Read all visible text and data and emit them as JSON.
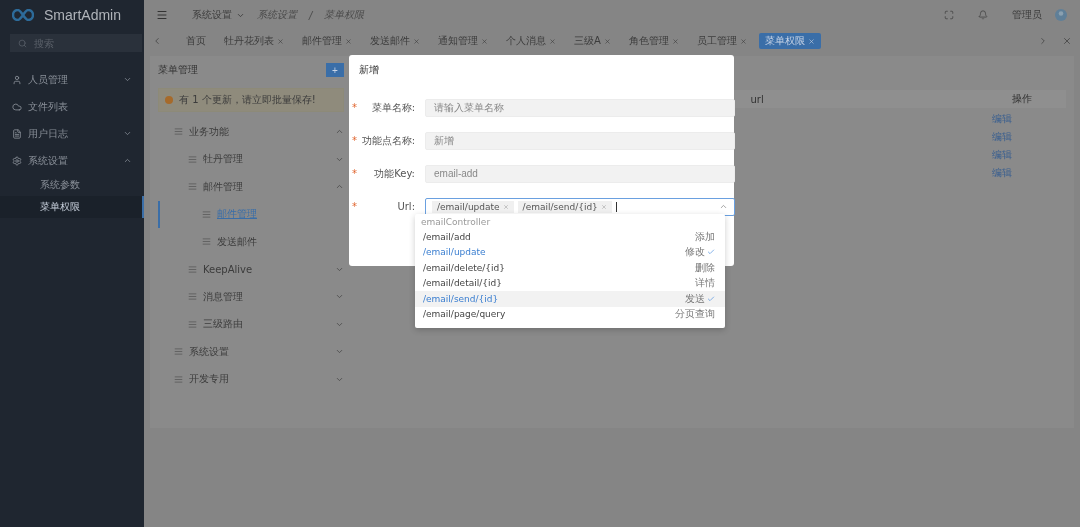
{
  "app": {
    "name": "SmartAdmin"
  },
  "sidebar": {
    "search_placeholder": "搜索",
    "items": [
      {
        "label": "人员管理",
        "expanded": false,
        "has_children": true,
        "selected": false
      },
      {
        "label": "文件列表",
        "has_children": false,
        "selected": false
      },
      {
        "label": "用户日志",
        "expanded": false,
        "has_children": true,
        "selected": false
      },
      {
        "label": "系统设置",
        "expanded": true,
        "has_children": true,
        "selected": false,
        "children": [
          {
            "label": "系统参数",
            "selected": false
          },
          {
            "label": "菜单权限",
            "selected": true
          }
        ]
      }
    ]
  },
  "header": {
    "module": "系统设置",
    "breadcrumb": [
      "系统设置",
      "菜单权限"
    ],
    "breadcrumb_separator": "/",
    "user": "管理员"
  },
  "tabs": [
    {
      "label": "首页",
      "selected": false,
      "closable": false
    },
    {
      "label": "牡丹花列表",
      "selected": false,
      "closable": true
    },
    {
      "label": "邮件管理",
      "selected": false,
      "closable": true
    },
    {
      "label": "发送邮件",
      "selected": false,
      "closable": true
    },
    {
      "label": "通知管理",
      "selected": false,
      "closable": true
    },
    {
      "label": "个人消息",
      "selected": false,
      "closable": true
    },
    {
      "label": "三级A",
      "selected": false,
      "closable": true
    },
    {
      "label": "角色管理",
      "selected": false,
      "closable": true
    },
    {
      "label": "员工管理",
      "selected": false,
      "closable": true
    },
    {
      "label": "菜单权限",
      "selected": true,
      "closable": true
    }
  ],
  "panel": {
    "title": "菜单管理",
    "add_button": "+",
    "alert": "有 1 个更新，请立即批量保存!"
  },
  "tree": [
    {
      "label": "业务功能",
      "expanded": true,
      "selected": false,
      "children": [
        {
          "label": "牡丹管理",
          "expanded": false,
          "selected": false
        },
        {
          "label": "邮件管理",
          "expanded": true,
          "selected": false,
          "children": [
            {
              "label": "邮件管理",
              "selected": true
            },
            {
              "label": "发送邮件",
              "selected": false
            }
          ]
        },
        {
          "label": "KeepAlive",
          "expanded": false,
          "selected": false
        },
        {
          "label": "消息管理",
          "expanded": false,
          "selected": false
        },
        {
          "label": "三级路由",
          "expanded": false,
          "selected": false
        }
      ]
    },
    {
      "label": "系统设置",
      "expanded": false,
      "selected": false
    },
    {
      "label": "开发专用",
      "expanded": false,
      "selected": false
    }
  ],
  "table": {
    "columns": [
      "url",
      "操作"
    ],
    "rows": [
      {
        "action": "编辑"
      },
      {
        "action": "编辑"
      },
      {
        "action": "编辑"
      },
      {
        "action": "编辑"
      }
    ]
  },
  "dialog": {
    "title": "新增",
    "fields": [
      {
        "required_mark": "*",
        "label": "菜单名称:",
        "placeholder": "请输入菜单名称",
        "disabled": true
      },
      {
        "required_mark": "*",
        "label": "功能点名称:",
        "value": "新增",
        "disabled": true
      },
      {
        "required_mark": "*",
        "label": "功能Key:",
        "value": "email-add",
        "disabled": true
      }
    ],
    "url_field": {
      "required_mark": "*",
      "label": "Url:",
      "tags": [
        "/email/update",
        "/email/send/{id}"
      ]
    },
    "dropdown": {
      "group": "emailController",
      "options": [
        {
          "path": "/email/add",
          "desc": "添加",
          "selected": false,
          "hover": false
        },
        {
          "path": "/email/update",
          "desc": "修改",
          "selected": true,
          "hover": false
        },
        {
          "path": "/email/delete/{id}",
          "desc": "删除",
          "selected": false,
          "hover": false
        },
        {
          "path": "/email/detail/{id}",
          "desc": "详情",
          "selected": false,
          "hover": false
        },
        {
          "path": "/email/send/{id}",
          "desc": "发送",
          "selected": true,
          "hover": true
        },
        {
          "path": "/email/page/query",
          "desc": "分页查询",
          "selected": false,
          "hover": false
        }
      ]
    }
  }
}
